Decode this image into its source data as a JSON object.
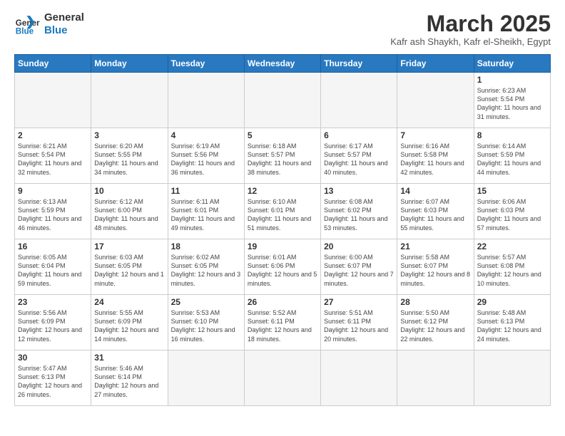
{
  "header": {
    "logo_general": "General",
    "logo_blue": "Blue",
    "month_title": "March 2025",
    "subtitle": "Kafr ash Shaykh, Kafr el-Sheikh, Egypt"
  },
  "weekdays": [
    "Sunday",
    "Monday",
    "Tuesday",
    "Wednesday",
    "Thursday",
    "Friday",
    "Saturday"
  ],
  "weeks": [
    [
      {
        "day": "",
        "info": ""
      },
      {
        "day": "",
        "info": ""
      },
      {
        "day": "",
        "info": ""
      },
      {
        "day": "",
        "info": ""
      },
      {
        "day": "",
        "info": ""
      },
      {
        "day": "",
        "info": ""
      },
      {
        "day": "1",
        "info": "Sunrise: 6:23 AM\nSunset: 5:54 PM\nDaylight: 11 hours and 31 minutes."
      }
    ],
    [
      {
        "day": "2",
        "info": "Sunrise: 6:21 AM\nSunset: 5:54 PM\nDaylight: 11 hours and 32 minutes."
      },
      {
        "day": "3",
        "info": "Sunrise: 6:20 AM\nSunset: 5:55 PM\nDaylight: 11 hours and 34 minutes."
      },
      {
        "day": "4",
        "info": "Sunrise: 6:19 AM\nSunset: 5:56 PM\nDaylight: 11 hours and 36 minutes."
      },
      {
        "day": "5",
        "info": "Sunrise: 6:18 AM\nSunset: 5:57 PM\nDaylight: 11 hours and 38 minutes."
      },
      {
        "day": "6",
        "info": "Sunrise: 6:17 AM\nSunset: 5:57 PM\nDaylight: 11 hours and 40 minutes."
      },
      {
        "day": "7",
        "info": "Sunrise: 6:16 AM\nSunset: 5:58 PM\nDaylight: 11 hours and 42 minutes."
      },
      {
        "day": "8",
        "info": "Sunrise: 6:14 AM\nSunset: 5:59 PM\nDaylight: 11 hours and 44 minutes."
      }
    ],
    [
      {
        "day": "9",
        "info": "Sunrise: 6:13 AM\nSunset: 5:59 PM\nDaylight: 11 hours and 46 minutes."
      },
      {
        "day": "10",
        "info": "Sunrise: 6:12 AM\nSunset: 6:00 PM\nDaylight: 11 hours and 48 minutes."
      },
      {
        "day": "11",
        "info": "Sunrise: 6:11 AM\nSunset: 6:01 PM\nDaylight: 11 hours and 49 minutes."
      },
      {
        "day": "12",
        "info": "Sunrise: 6:10 AM\nSunset: 6:01 PM\nDaylight: 11 hours and 51 minutes."
      },
      {
        "day": "13",
        "info": "Sunrise: 6:08 AM\nSunset: 6:02 PM\nDaylight: 11 hours and 53 minutes."
      },
      {
        "day": "14",
        "info": "Sunrise: 6:07 AM\nSunset: 6:03 PM\nDaylight: 11 hours and 55 minutes."
      },
      {
        "day": "15",
        "info": "Sunrise: 6:06 AM\nSunset: 6:03 PM\nDaylight: 11 hours and 57 minutes."
      }
    ],
    [
      {
        "day": "16",
        "info": "Sunrise: 6:05 AM\nSunset: 6:04 PM\nDaylight: 11 hours and 59 minutes."
      },
      {
        "day": "17",
        "info": "Sunrise: 6:03 AM\nSunset: 6:05 PM\nDaylight: 12 hours and 1 minute."
      },
      {
        "day": "18",
        "info": "Sunrise: 6:02 AM\nSunset: 6:05 PM\nDaylight: 12 hours and 3 minutes."
      },
      {
        "day": "19",
        "info": "Sunrise: 6:01 AM\nSunset: 6:06 PM\nDaylight: 12 hours and 5 minutes."
      },
      {
        "day": "20",
        "info": "Sunrise: 6:00 AM\nSunset: 6:07 PM\nDaylight: 12 hours and 7 minutes."
      },
      {
        "day": "21",
        "info": "Sunrise: 5:58 AM\nSunset: 6:07 PM\nDaylight: 12 hours and 8 minutes."
      },
      {
        "day": "22",
        "info": "Sunrise: 5:57 AM\nSunset: 6:08 PM\nDaylight: 12 hours and 10 minutes."
      }
    ],
    [
      {
        "day": "23",
        "info": "Sunrise: 5:56 AM\nSunset: 6:09 PM\nDaylight: 12 hours and 12 minutes."
      },
      {
        "day": "24",
        "info": "Sunrise: 5:55 AM\nSunset: 6:09 PM\nDaylight: 12 hours and 14 minutes."
      },
      {
        "day": "25",
        "info": "Sunrise: 5:53 AM\nSunset: 6:10 PM\nDaylight: 12 hours and 16 minutes."
      },
      {
        "day": "26",
        "info": "Sunrise: 5:52 AM\nSunset: 6:11 PM\nDaylight: 12 hours and 18 minutes."
      },
      {
        "day": "27",
        "info": "Sunrise: 5:51 AM\nSunset: 6:11 PM\nDaylight: 12 hours and 20 minutes."
      },
      {
        "day": "28",
        "info": "Sunrise: 5:50 AM\nSunset: 6:12 PM\nDaylight: 12 hours and 22 minutes."
      },
      {
        "day": "29",
        "info": "Sunrise: 5:48 AM\nSunset: 6:13 PM\nDaylight: 12 hours and 24 minutes."
      }
    ],
    [
      {
        "day": "30",
        "info": "Sunrise: 5:47 AM\nSunset: 6:13 PM\nDaylight: 12 hours and 26 minutes."
      },
      {
        "day": "31",
        "info": "Sunrise: 5:46 AM\nSunset: 6:14 PM\nDaylight: 12 hours and 27 minutes."
      },
      {
        "day": "",
        "info": ""
      },
      {
        "day": "",
        "info": ""
      },
      {
        "day": "",
        "info": ""
      },
      {
        "day": "",
        "info": ""
      },
      {
        "day": "",
        "info": ""
      }
    ]
  ]
}
